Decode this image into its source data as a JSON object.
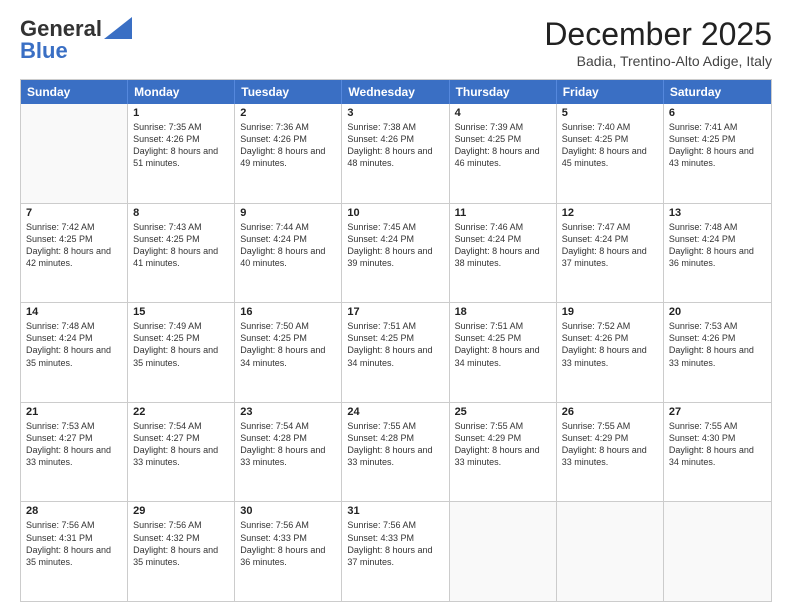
{
  "header": {
    "logo_general": "General",
    "logo_blue": "Blue",
    "month_title": "December 2025",
    "location": "Badia, Trentino-Alto Adige, Italy"
  },
  "weekdays": [
    "Sunday",
    "Monday",
    "Tuesday",
    "Wednesday",
    "Thursday",
    "Friday",
    "Saturday"
  ],
  "weeks": [
    [
      {
        "day": "",
        "sunrise": "",
        "sunset": "",
        "daylight": ""
      },
      {
        "day": "1",
        "sunrise": "Sunrise: 7:35 AM",
        "sunset": "Sunset: 4:26 PM",
        "daylight": "Daylight: 8 hours and 51 minutes."
      },
      {
        "day": "2",
        "sunrise": "Sunrise: 7:36 AM",
        "sunset": "Sunset: 4:26 PM",
        "daylight": "Daylight: 8 hours and 49 minutes."
      },
      {
        "day": "3",
        "sunrise": "Sunrise: 7:38 AM",
        "sunset": "Sunset: 4:26 PM",
        "daylight": "Daylight: 8 hours and 48 minutes."
      },
      {
        "day": "4",
        "sunrise": "Sunrise: 7:39 AM",
        "sunset": "Sunset: 4:25 PM",
        "daylight": "Daylight: 8 hours and 46 minutes."
      },
      {
        "day": "5",
        "sunrise": "Sunrise: 7:40 AM",
        "sunset": "Sunset: 4:25 PM",
        "daylight": "Daylight: 8 hours and 45 minutes."
      },
      {
        "day": "6",
        "sunrise": "Sunrise: 7:41 AM",
        "sunset": "Sunset: 4:25 PM",
        "daylight": "Daylight: 8 hours and 43 minutes."
      }
    ],
    [
      {
        "day": "7",
        "sunrise": "Sunrise: 7:42 AM",
        "sunset": "Sunset: 4:25 PM",
        "daylight": "Daylight: 8 hours and 42 minutes."
      },
      {
        "day": "8",
        "sunrise": "Sunrise: 7:43 AM",
        "sunset": "Sunset: 4:25 PM",
        "daylight": "Daylight: 8 hours and 41 minutes."
      },
      {
        "day": "9",
        "sunrise": "Sunrise: 7:44 AM",
        "sunset": "Sunset: 4:24 PM",
        "daylight": "Daylight: 8 hours and 40 minutes."
      },
      {
        "day": "10",
        "sunrise": "Sunrise: 7:45 AM",
        "sunset": "Sunset: 4:24 PM",
        "daylight": "Daylight: 8 hours and 39 minutes."
      },
      {
        "day": "11",
        "sunrise": "Sunrise: 7:46 AM",
        "sunset": "Sunset: 4:24 PM",
        "daylight": "Daylight: 8 hours and 38 minutes."
      },
      {
        "day": "12",
        "sunrise": "Sunrise: 7:47 AM",
        "sunset": "Sunset: 4:24 PM",
        "daylight": "Daylight: 8 hours and 37 minutes."
      },
      {
        "day": "13",
        "sunrise": "Sunrise: 7:48 AM",
        "sunset": "Sunset: 4:24 PM",
        "daylight": "Daylight: 8 hours and 36 minutes."
      }
    ],
    [
      {
        "day": "14",
        "sunrise": "Sunrise: 7:48 AM",
        "sunset": "Sunset: 4:24 PM",
        "daylight": "Daylight: 8 hours and 35 minutes."
      },
      {
        "day": "15",
        "sunrise": "Sunrise: 7:49 AM",
        "sunset": "Sunset: 4:25 PM",
        "daylight": "Daylight: 8 hours and 35 minutes."
      },
      {
        "day": "16",
        "sunrise": "Sunrise: 7:50 AM",
        "sunset": "Sunset: 4:25 PM",
        "daylight": "Daylight: 8 hours and 34 minutes."
      },
      {
        "day": "17",
        "sunrise": "Sunrise: 7:51 AM",
        "sunset": "Sunset: 4:25 PM",
        "daylight": "Daylight: 8 hours and 34 minutes."
      },
      {
        "day": "18",
        "sunrise": "Sunrise: 7:51 AM",
        "sunset": "Sunset: 4:25 PM",
        "daylight": "Daylight: 8 hours and 34 minutes."
      },
      {
        "day": "19",
        "sunrise": "Sunrise: 7:52 AM",
        "sunset": "Sunset: 4:26 PM",
        "daylight": "Daylight: 8 hours and 33 minutes."
      },
      {
        "day": "20",
        "sunrise": "Sunrise: 7:53 AM",
        "sunset": "Sunset: 4:26 PM",
        "daylight": "Daylight: 8 hours and 33 minutes."
      }
    ],
    [
      {
        "day": "21",
        "sunrise": "Sunrise: 7:53 AM",
        "sunset": "Sunset: 4:27 PM",
        "daylight": "Daylight: 8 hours and 33 minutes."
      },
      {
        "day": "22",
        "sunrise": "Sunrise: 7:54 AM",
        "sunset": "Sunset: 4:27 PM",
        "daylight": "Daylight: 8 hours and 33 minutes."
      },
      {
        "day": "23",
        "sunrise": "Sunrise: 7:54 AM",
        "sunset": "Sunset: 4:28 PM",
        "daylight": "Daylight: 8 hours and 33 minutes."
      },
      {
        "day": "24",
        "sunrise": "Sunrise: 7:55 AM",
        "sunset": "Sunset: 4:28 PM",
        "daylight": "Daylight: 8 hours and 33 minutes."
      },
      {
        "day": "25",
        "sunrise": "Sunrise: 7:55 AM",
        "sunset": "Sunset: 4:29 PM",
        "daylight": "Daylight: 8 hours and 33 minutes."
      },
      {
        "day": "26",
        "sunrise": "Sunrise: 7:55 AM",
        "sunset": "Sunset: 4:29 PM",
        "daylight": "Daylight: 8 hours and 33 minutes."
      },
      {
        "day": "27",
        "sunrise": "Sunrise: 7:55 AM",
        "sunset": "Sunset: 4:30 PM",
        "daylight": "Daylight: 8 hours and 34 minutes."
      }
    ],
    [
      {
        "day": "28",
        "sunrise": "Sunrise: 7:56 AM",
        "sunset": "Sunset: 4:31 PM",
        "daylight": "Daylight: 8 hours and 35 minutes."
      },
      {
        "day": "29",
        "sunrise": "Sunrise: 7:56 AM",
        "sunset": "Sunset: 4:32 PM",
        "daylight": "Daylight: 8 hours and 35 minutes."
      },
      {
        "day": "30",
        "sunrise": "Sunrise: 7:56 AM",
        "sunset": "Sunset: 4:33 PM",
        "daylight": "Daylight: 8 hours and 36 minutes."
      },
      {
        "day": "31",
        "sunrise": "Sunrise: 7:56 AM",
        "sunset": "Sunset: 4:33 PM",
        "daylight": "Daylight: 8 hours and 37 minutes."
      },
      {
        "day": "",
        "sunrise": "",
        "sunset": "",
        "daylight": ""
      },
      {
        "day": "",
        "sunrise": "",
        "sunset": "",
        "daylight": ""
      },
      {
        "day": "",
        "sunrise": "",
        "sunset": "",
        "daylight": ""
      }
    ]
  ]
}
